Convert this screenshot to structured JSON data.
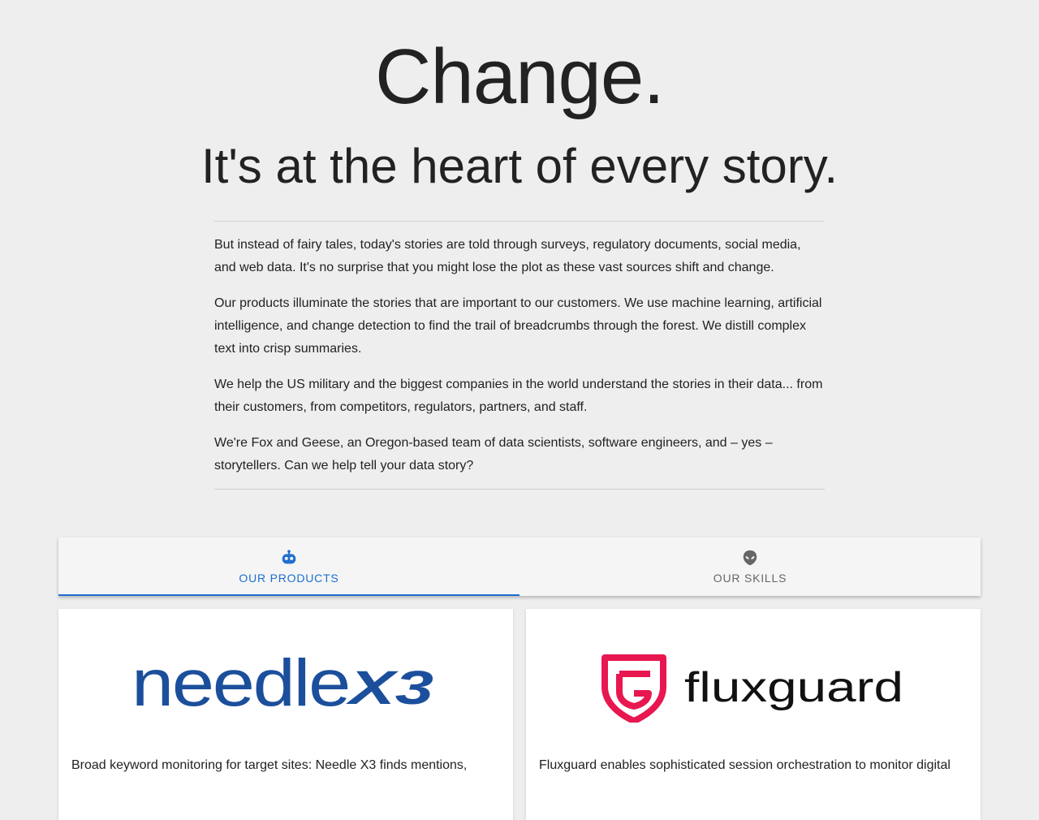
{
  "hero": {
    "title": "Change.",
    "subtitle": "It's at the heart of every story."
  },
  "intro": {
    "paragraphs": [
      "But instead of fairy tales, today's stories are told through surveys, regulatory documents, social media, and web data. It's no surprise that you might lose the plot as these vast sources shift and change.",
      "Our products illuminate the stories that are important to our customers. We use machine learning, artificial intelligence, and change detection to find the trail of breadcrumbs through the forest. We distill complex text into crisp summaries.",
      "We help the US military and the biggest companies in the world understand the stories in their data... from their customers, from competitors, regulators, partners, and staff.",
      "We're Fox and Geese, an Oregon-based team of data scientists, software engineers, and – yes – storytellers. Can we help tell your data story?"
    ]
  },
  "tabs": [
    {
      "label": "OUR PRODUCTS",
      "icon": "robot-icon",
      "active": true
    },
    {
      "label": "OUR SKILLS",
      "icon": "alien-icon",
      "active": false
    }
  ],
  "products": [
    {
      "logo": {
        "text": "needle",
        "badge": "X3",
        "color": "#1b4f9c"
      },
      "description": "Broad keyword monitoring for target sites: Needle X3 finds mentions,"
    },
    {
      "logo": {
        "text": "fluxguard",
        "color": "#e8174f"
      },
      "description": "Fluxguard enables sophisticated session orchestration to monitor digital"
    }
  ],
  "colors": {
    "background": "#eeeeee",
    "accent": "#1e6fd0",
    "needle_blue": "#1b4f9c",
    "fluxguard_red": "#e8174f"
  }
}
